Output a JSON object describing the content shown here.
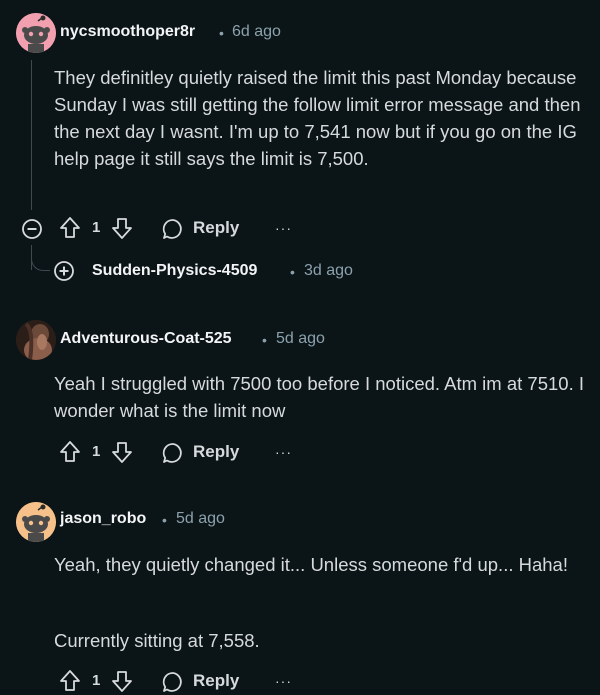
{
  "comments": [
    {
      "username": "nycsmoothoper8r",
      "separator": "•",
      "time": "6d ago",
      "body": "They definitley quietly raised the limit this past Monday because Sunday I was still getting the follow limit error message and then the next day I wasnt. I'm up to 7,541 now but if you go on the IG help page it still says the limit is 7,500.",
      "votes": "1",
      "reply_label": "Reply",
      "more_label": "···"
    },
    {
      "username": "Adventurous-Coat-525",
      "separator": "•",
      "time": "5d ago",
      "body": "Yeah I struggled with 7500 too before I noticed. Atm im at 7510. I wonder what is the limit now",
      "votes": "1",
      "reply_label": "Reply",
      "more_label": "···"
    },
    {
      "username": "jason_robo",
      "separator": "•",
      "time": "5d ago",
      "body_p1": "Yeah, they quietly changed it... Unless someone f'd up... Haha!",
      "body_p2": "Currently sitting at 7,558.",
      "votes": "1",
      "reply_label": "Reply",
      "more_label": "···"
    }
  ],
  "collapsed_reply": {
    "username": "Sudden-Physics-4509",
    "separator": "•",
    "time": "3d ago"
  },
  "colors": {
    "background": "#0b1416",
    "text": "#d7dadc",
    "meta": "#8ba2ad",
    "avatar_pink": "#f2a0b0",
    "avatar_peach": "#f6c08a"
  }
}
